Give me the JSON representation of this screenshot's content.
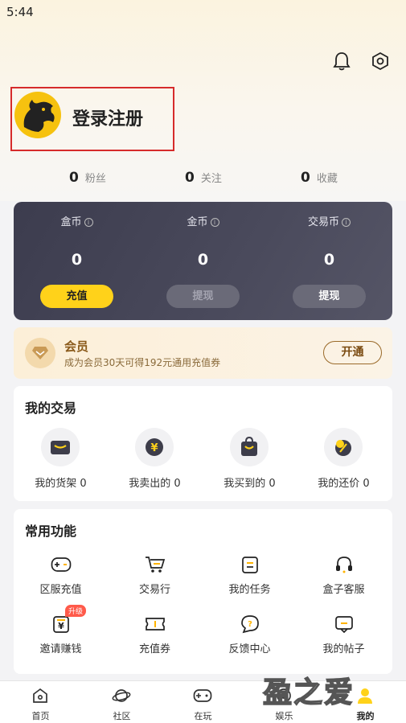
{
  "status_bar": {
    "time": "5:44"
  },
  "header": {
    "bell_icon": "bell-icon",
    "settings_icon": "settings-hex-icon"
  },
  "user": {
    "login_label": "登录注册",
    "avatar_icon": "dragon-avatar"
  },
  "stats": [
    {
      "value": "0",
      "label": "粉丝"
    },
    {
      "value": "0",
      "label": "关注"
    },
    {
      "value": "0",
      "label": "收藏"
    }
  ],
  "wallet": {
    "columns": [
      {
        "label": "盒币",
        "value": "0",
        "button": "充值"
      },
      {
        "label": "金币",
        "value": "0",
        "button": "提现"
      },
      {
        "label": "交易币",
        "value": "0",
        "button": "提现"
      }
    ],
    "info_glyph": "i"
  },
  "vip": {
    "title": "会员",
    "subtitle": "成为会员30天可得192元通用充值券",
    "button": "开通"
  },
  "trade": {
    "title": "我的交易",
    "items": [
      {
        "label": "我的货架 0",
        "icon": "shelf-icon"
      },
      {
        "label": "我卖出的 0",
        "icon": "yen-coin-icon"
      },
      {
        "label": "我买到的 0",
        "icon": "shopping-bag-icon"
      },
      {
        "label": "我的还价 0",
        "icon": "bargain-icon"
      }
    ]
  },
  "common": {
    "title": "常用功能",
    "items": [
      {
        "label": "区服充值",
        "icon": "gamepad-icon"
      },
      {
        "label": "交易行",
        "icon": "cart-icon"
      },
      {
        "label": "我的任务",
        "icon": "task-icon"
      },
      {
        "label": "盒子客服",
        "icon": "headset-icon"
      },
      {
        "label": "邀请赚钱",
        "icon": "invite-icon",
        "badge": "升级"
      },
      {
        "label": "充值券",
        "icon": "ticket-icon"
      },
      {
        "label": "反馈中心",
        "icon": "feedback-icon"
      },
      {
        "label": "我的帖子",
        "icon": "post-icon"
      }
    ]
  },
  "tabbar": [
    {
      "label": "首页",
      "icon": "home-icon"
    },
    {
      "label": "社区",
      "icon": "planet-icon"
    },
    {
      "label": "在玩",
      "icon": "gamepad-tab-icon"
    },
    {
      "label": "娱乐",
      "icon": "fun-icon"
    },
    {
      "label": "我的",
      "icon": "me-icon",
      "selected": true
    }
  ],
  "watermark": "盈之爱",
  "colors": {
    "accent": "#ffd21a",
    "wallet_bg": "#44444f",
    "badge": "#ff5a4a",
    "selection": "#d62b2b"
  }
}
